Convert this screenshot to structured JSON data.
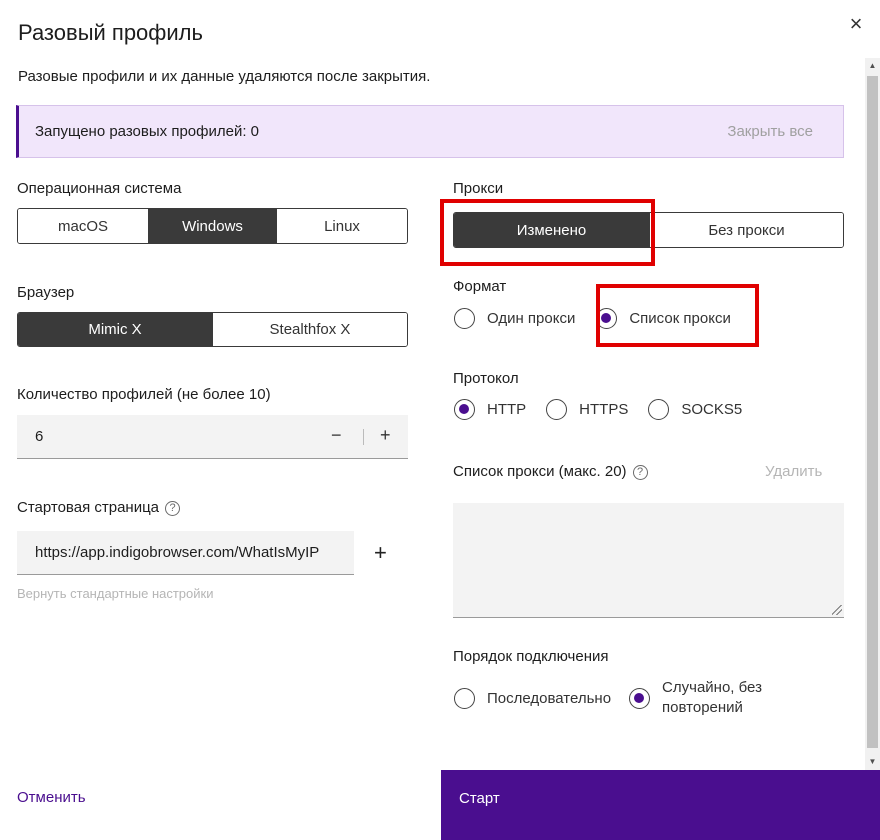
{
  "dialog": {
    "title": "Разовый профиль",
    "subtitle": "Разовые профили и их данные удаляются после закрытия.",
    "close_icon": "×"
  },
  "banner": {
    "text": "Запущено разовых профилей: 0",
    "close_all": "Закрыть все"
  },
  "os": {
    "label": "Операционная система",
    "options": [
      "macOS",
      "Windows",
      "Linux"
    ],
    "selected": "Windows"
  },
  "browser": {
    "label": "Браузер",
    "options": [
      "Mimic X",
      "Stealthfox X"
    ],
    "selected": "Mimic X"
  },
  "profiles_count": {
    "label": "Количество профилей (не более 10)",
    "value": "6",
    "minus": "−",
    "plus": "+"
  },
  "start_page": {
    "label": "Стартовая страница",
    "help": "?",
    "url": "https://app.indigobrowser.com/WhatIsMyIP",
    "add": "+",
    "reset": "Вернуть стандартные настройки"
  },
  "proxy": {
    "label": "Прокси",
    "options": [
      "Изменено",
      "Без прокси"
    ],
    "selected": "Изменено"
  },
  "format": {
    "label": "Формат",
    "options": [
      "Один прокси",
      "Список прокси"
    ],
    "selected": "Список прокси"
  },
  "protocol": {
    "label": "Протокол",
    "options": [
      "HTTP",
      "HTTPS",
      "SOCKS5"
    ],
    "selected": "HTTP"
  },
  "proxy_list": {
    "label": "Список прокси (макс. 20)",
    "help": "?",
    "delete": "Удалить",
    "value": ""
  },
  "connection_order": {
    "label": "Порядок подключения",
    "options": [
      "Последовательно",
      "Случайно, без повторений"
    ],
    "selected": "Случайно, без повторений"
  },
  "footer": {
    "cancel": "Отменить",
    "start": "Старт"
  },
  "colors": {
    "accent": "#4a0e8f",
    "highlight": "#e00000",
    "banner_bg": "#f1e6fb"
  }
}
